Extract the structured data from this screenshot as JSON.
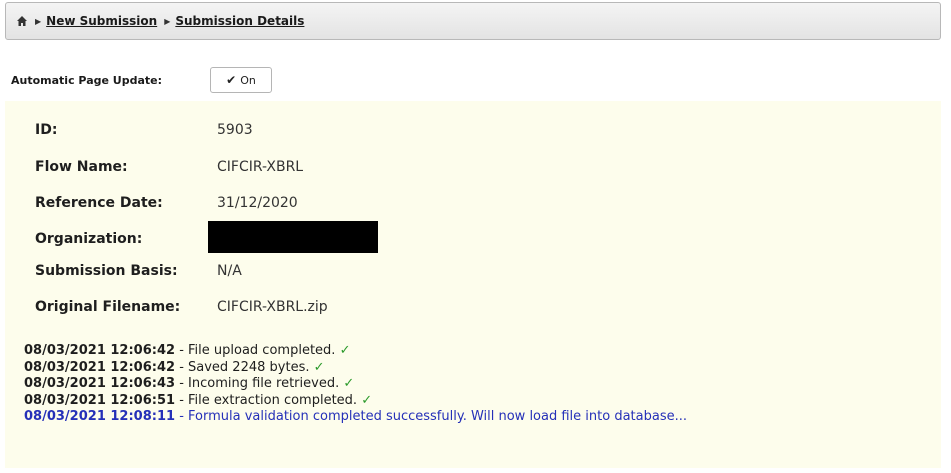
{
  "breadcrumb": {
    "home_icon": "home-icon",
    "separator": "▶",
    "items": [
      "New Submission",
      "Submission Details"
    ]
  },
  "auto_update": {
    "label": "Automatic Page Update:",
    "button_label": "On",
    "check_glyph": "✔"
  },
  "details": [
    {
      "label": "ID:",
      "value": "5903"
    },
    {
      "label": "Flow Name:",
      "value": "CIFCIR-XBRL"
    },
    {
      "label": "Reference Date:",
      "value": "31/12/2020"
    },
    {
      "label": "Organization:",
      "value": ""
    },
    {
      "label": "Submission Basis:",
      "value": "N/A"
    },
    {
      "label": "Original Filename:",
      "value": "CIFCIR-XBRL.zip"
    }
  ],
  "log": [
    {
      "time": "08/03/2021 12:06:42",
      "message": " - File upload completed. ",
      "tick": "✓"
    },
    {
      "time": "08/03/2021 12:06:42",
      "message": " - Saved 2248 bytes. ",
      "tick": "✓"
    },
    {
      "time": "08/03/2021 12:06:43",
      "message": " - Incoming file retrieved. ",
      "tick": "✓"
    },
    {
      "time": "08/03/2021 12:06:51",
      "message": " - File extraction completed. ",
      "tick": "✓"
    },
    {
      "time": "08/03/2021 12:08:11",
      "message": " - Formula validation completed successfully. Will now load file into database...",
      "tick": ""
    }
  ],
  "colors": {
    "panel_background": "#fdfdec",
    "log_info": "#2530b8",
    "tick": "#2b9a2b"
  }
}
